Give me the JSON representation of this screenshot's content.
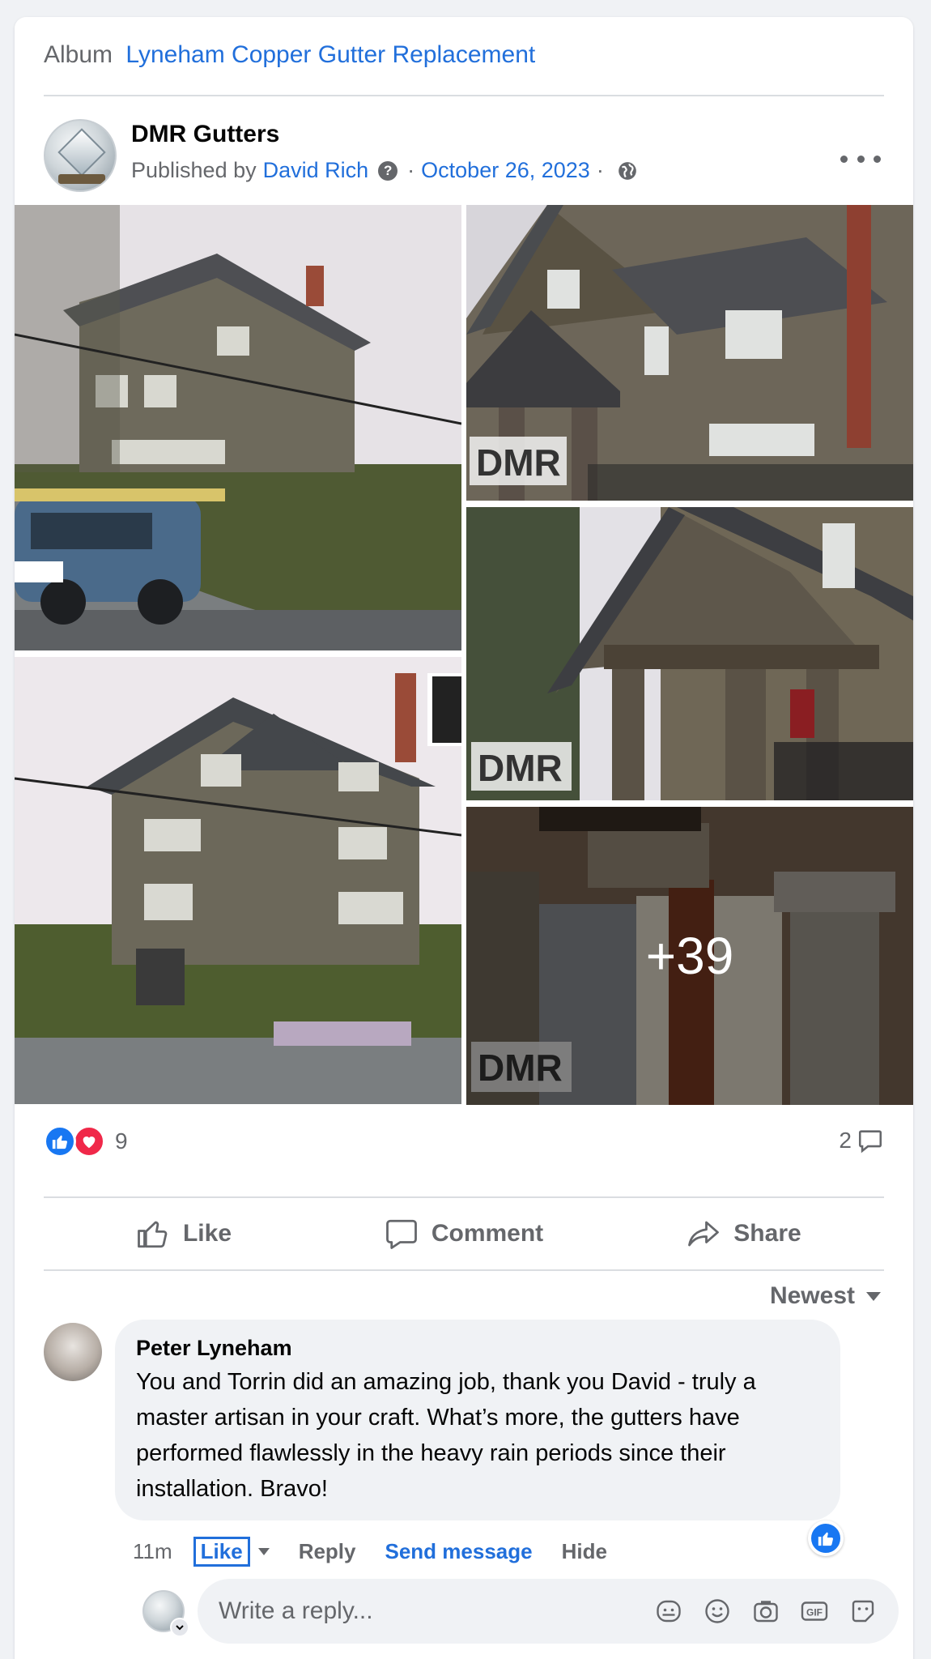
{
  "album": {
    "prefix": "Album",
    "name": "Lyneham Copper Gutter Replacement"
  },
  "post": {
    "page_name": "DMR Gutters",
    "published_by_prefix": "Published by",
    "author": "David Rich",
    "date": "October 26, 2023",
    "more_photos_count": "+39",
    "watermark": "DMR"
  },
  "reactions": {
    "count": "9",
    "comment_count": "2"
  },
  "actions": {
    "like": "Like",
    "comment": "Comment",
    "share": "Share"
  },
  "sort": {
    "label": "Newest"
  },
  "comment": {
    "author": "Peter Lyneham",
    "text": "You and Torrin did an amazing job, thank you David - truly a master artisan in your craft. What’s more, the gutters have performed flawlessly in the heavy rain periods since their installation. Bravo!",
    "time": "11m",
    "like": "Like",
    "reply": "Reply",
    "send_message": "Send message",
    "hide": "Hide"
  },
  "reply_box": {
    "placeholder": "Write a reply..."
  },
  "colors": {
    "link": "#216fdb",
    "like_blue": "#1877f2",
    "love_red": "#f02849",
    "secondary_text": "#65676b"
  },
  "icons": [
    "question-icon",
    "globe-icon",
    "more-icon",
    "like-icon",
    "comment-icon",
    "share-icon",
    "sticker-icon",
    "emoji-icon",
    "camera-icon",
    "gif-icon",
    "avatar-sticker-icon"
  ]
}
